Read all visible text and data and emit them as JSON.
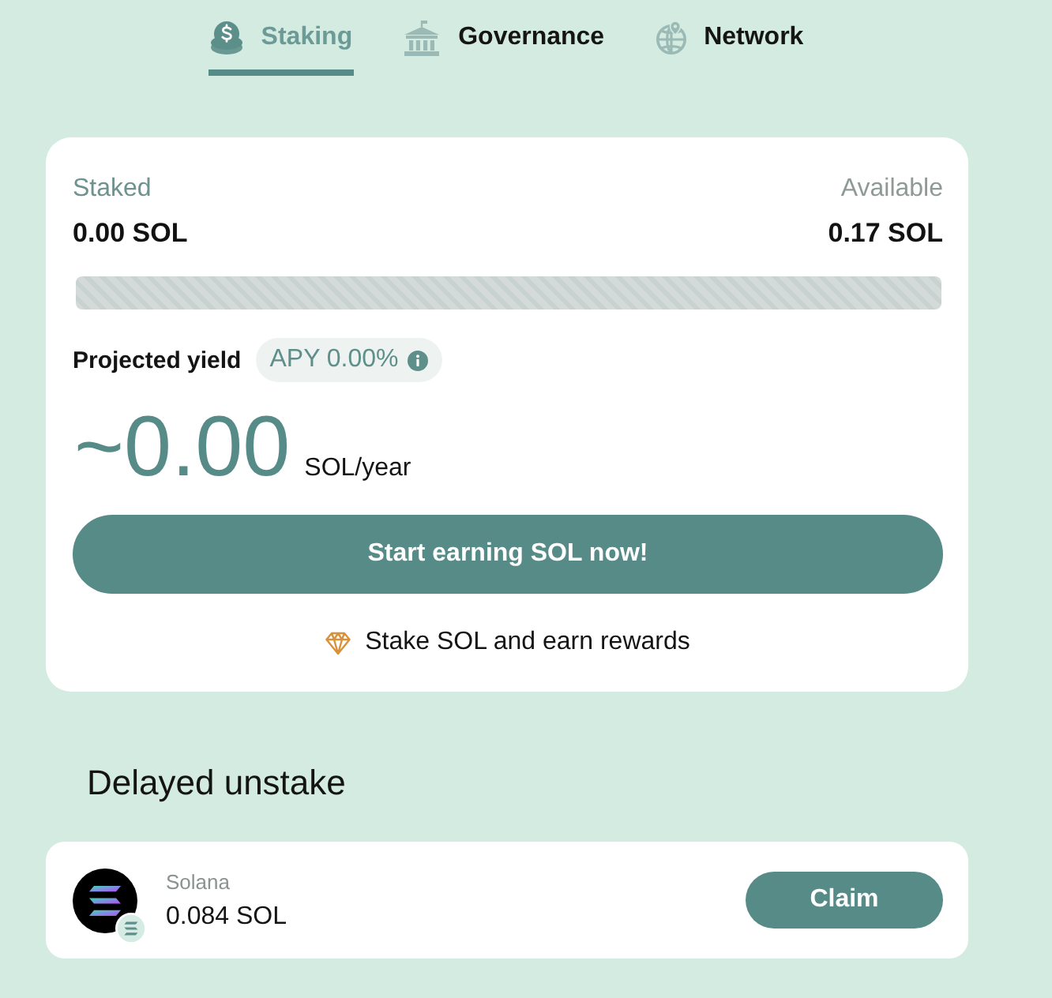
{
  "tabs": [
    {
      "label": "Staking",
      "selected": true
    },
    {
      "label": "Governance",
      "selected": false
    },
    {
      "label": "Network",
      "selected": false
    }
  ],
  "staking": {
    "staked": {
      "label": "Staked",
      "value": "0.00 SOL"
    },
    "available": {
      "label": "Available",
      "value": "0.17 SOL"
    },
    "projected_yield": {
      "label": "Projected yield",
      "apy": "APY 0.00%",
      "amount": "~0.00",
      "unit": "SOL/year"
    },
    "button": "Start earning SOL now!",
    "note": "Stake SOL and earn rewards"
  },
  "delayed_unstake": {
    "title": "Delayed unstake",
    "items": [
      {
        "name": "Solana",
        "amount": "0.084 SOL",
        "button": "Claim"
      }
    ]
  }
}
